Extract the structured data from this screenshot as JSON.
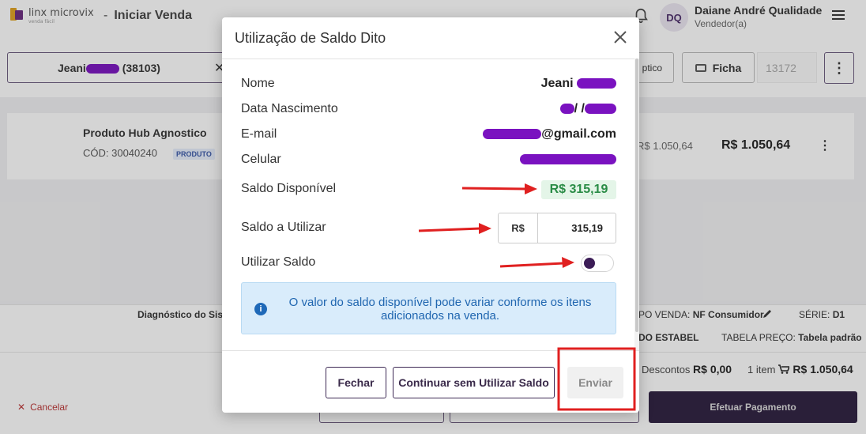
{
  "header": {
    "logo_text": "linx microvix",
    "logo_sub": "venda fácil",
    "dash": "-",
    "page_title": "Iniciar Venda",
    "avatar_initials": "DQ",
    "user_name": "Daiane André Qualidade",
    "user_role": "Vendedor(a)"
  },
  "toolbar": {
    "customer_prefix": "Jeani",
    "customer_code": "(38103)",
    "otico_label": "ptico",
    "ficha_label": "Ficha",
    "ficha_value": "13172"
  },
  "product": {
    "name": "Produto Hub Agnostico",
    "code": "CÓD: 30040240",
    "badge": "PRODUTO",
    "unit_price": "R$ 1.050,64",
    "total": "R$ 1.050,64"
  },
  "info_bar": {
    "diag_label": "Diagnóstico do Siste",
    "tipo_venda_label": "PO VENDA:",
    "tipo_venda_value": "NF Consumidor",
    "serie_label": "SÉRIE:",
    "serie_value": "D1",
    "estabel": "DO ESTABEL",
    "tabela_label": "TABELA PREÇO:",
    "tabela_value": "Tabela padrão"
  },
  "footer": {
    "descontos_label": "Descontos",
    "descontos_value": "R$ 0,00",
    "items_count": "1 item",
    "items_total": "R$ 1.050,64",
    "cancel_label": "Cancelar",
    "pay_label": "Efetuar Pagamento"
  },
  "modal": {
    "title": "Utilização de Saldo Dito",
    "rows": [
      {
        "label": "Nome",
        "value": "Jeani"
      },
      {
        "label": "Data Nascimento",
        "value": "/ /"
      },
      {
        "label": "E-mail",
        "value": "@gmail.com"
      },
      {
        "label": "Celular",
        "value": ""
      }
    ],
    "saldo_disponivel_label": "Saldo Disponível",
    "saldo_disponivel_value": "R$ 315,19",
    "saldo_utilizar_label": "Saldo a Utilizar",
    "saldo_utilizar_prefix": "R$",
    "saldo_utilizar_value": "315,19",
    "utilizar_saldo_label": "Utilizar Saldo",
    "utilizar_saldo_on": false,
    "info_icon_glyph": "i",
    "info_text": "O valor do saldo disponível pode variar conforme os itens adicionados na venda.",
    "buttons": {
      "fechar": "Fechar",
      "continuar": "Continuar sem Utilizar Saldo",
      "enviar": "Enviar"
    }
  },
  "colors": {
    "brand_dark": "#2b1d3e",
    "saldo_green": "#2a8c46",
    "info_blue": "#2066b0",
    "annotation_red": "#e02020",
    "redaction": "#7a12c0"
  }
}
